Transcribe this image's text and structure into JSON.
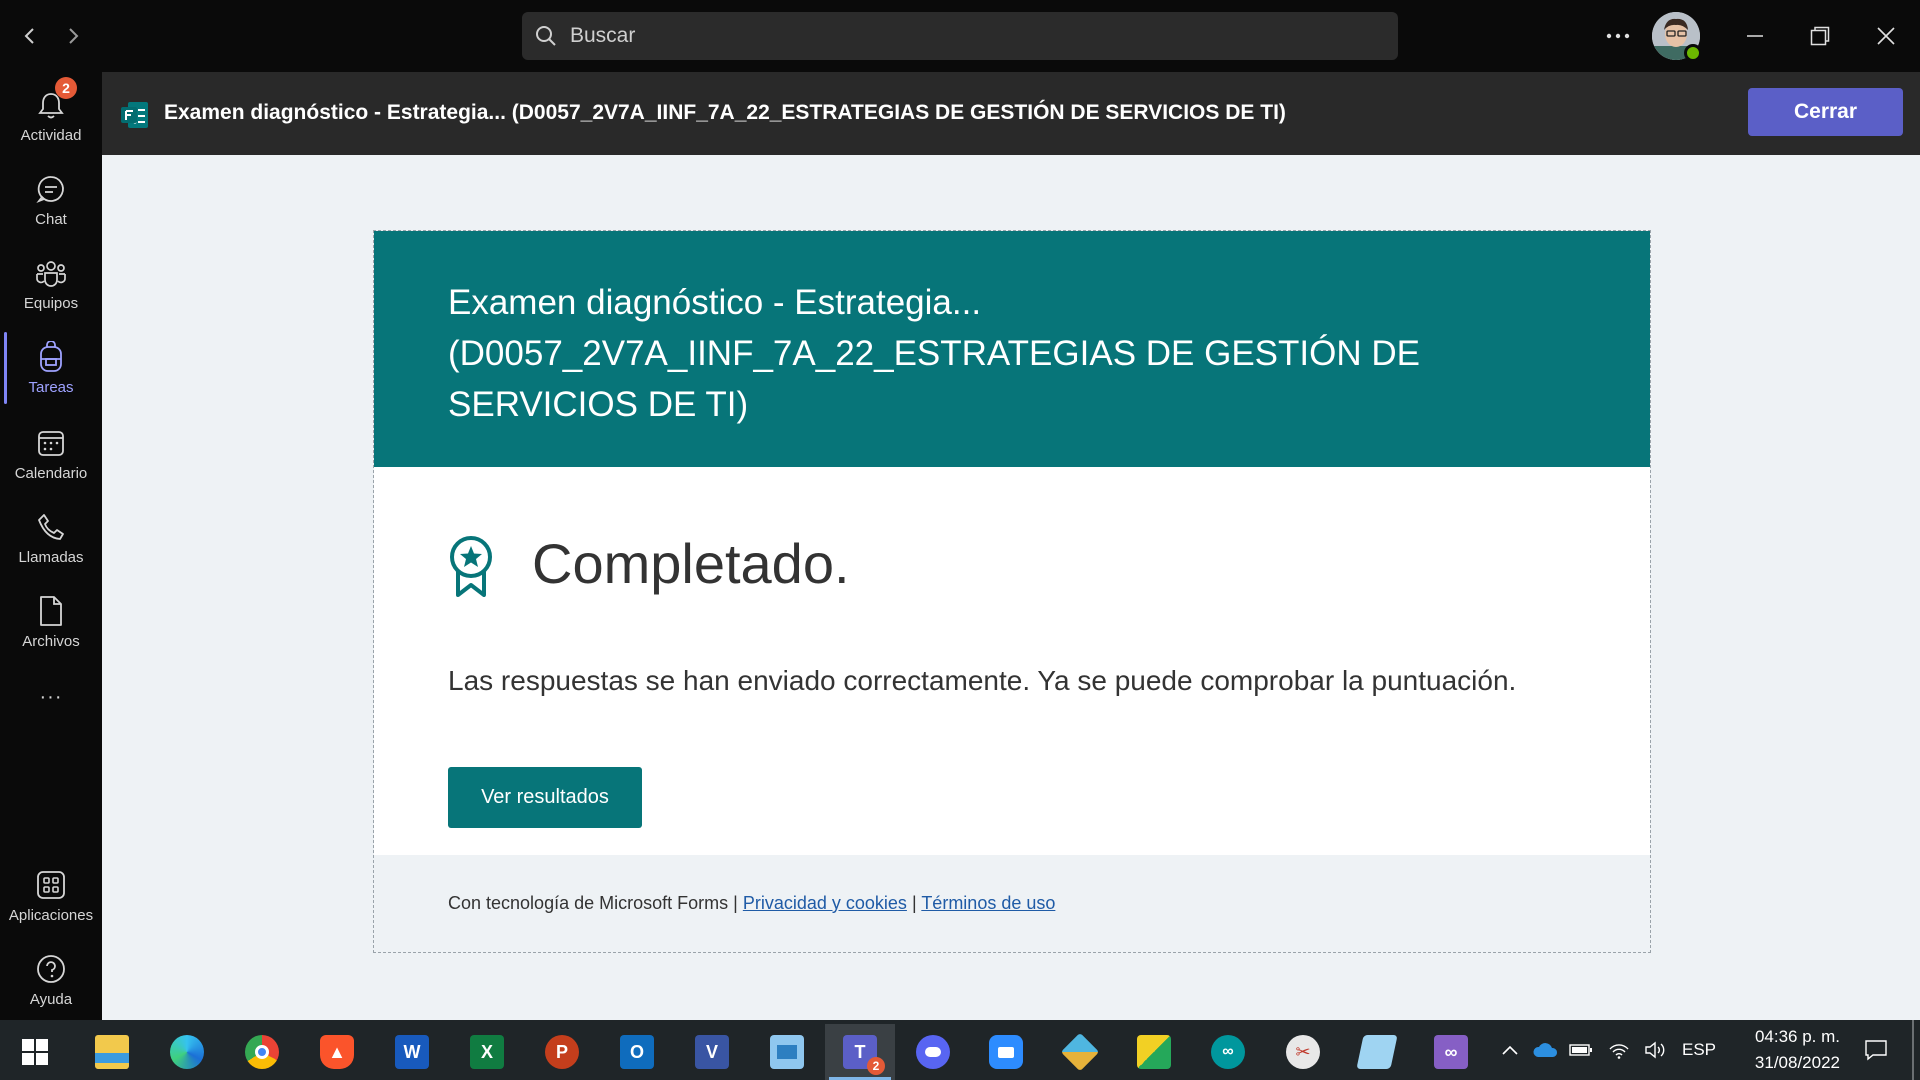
{
  "titlebar": {
    "search_placeholder": "Buscar",
    "more_label": "···"
  },
  "rail": {
    "activity": {
      "label": "Actividad",
      "badge": "2"
    },
    "chat": {
      "label": "Chat"
    },
    "teams": {
      "label": "Equipos"
    },
    "assignments": {
      "label": "Tareas"
    },
    "calendar": {
      "label": "Calendario"
    },
    "calls": {
      "label": "Llamadas"
    },
    "files": {
      "label": "Archivos"
    },
    "more": {
      "label": "···"
    },
    "apps": {
      "label": "Aplicaciones"
    },
    "help": {
      "label": "Ayuda"
    }
  },
  "app_header": {
    "title": "Examen diagnóstico - Estrategia... (D0057_2V7A_IINF_7A_22_ESTRATEGIAS DE GESTIÓN DE SERVICIOS DE TI)",
    "close_label": "Cerrar"
  },
  "form": {
    "title": "Examen diagnóstico - Estrategia... (D0057_2V7A_IINF_7A_22_ESTRATEGIAS DE GESTIÓN DE SERVICIOS DE TI)",
    "completed": "Completado.",
    "message": "Las respuestas se han enviado correctamente. Ya se puede comprobar la puntuación.",
    "results_button": "Ver resultados",
    "footer": {
      "powered": "Con tecnología de Microsoft Forms",
      "sep": "|",
      "privacy": "Privacidad y cookies",
      "terms": "Términos de uso"
    }
  },
  "taskbar": {
    "teams_badge": "2",
    "language": "ESP",
    "time": "04:36 p. m.",
    "date": "31/08/2022"
  },
  "colors": {
    "teams_accent": "#5b5fc7",
    "forms_teal": "#077579",
    "badge_red": "#e45a37",
    "presence_green": "#6bb700"
  }
}
